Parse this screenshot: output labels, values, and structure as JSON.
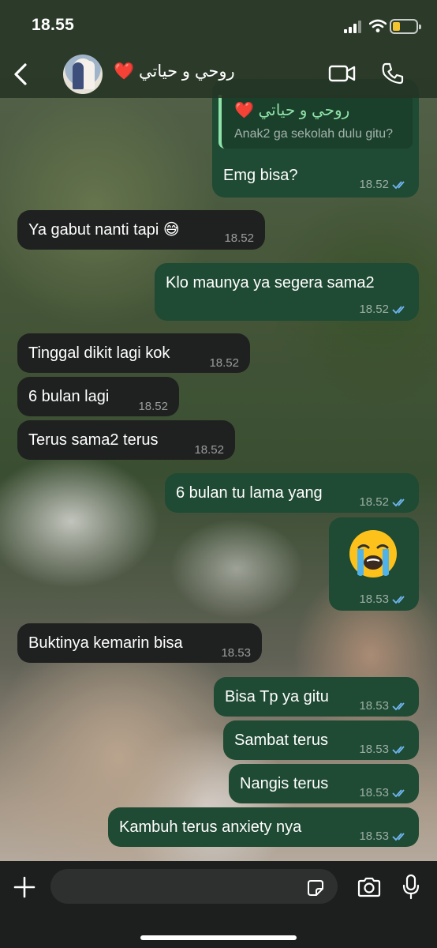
{
  "status_bar": {
    "time": "18.55"
  },
  "header": {
    "contact_name": "روحي و حياتي",
    "heart": "❤️"
  },
  "messages": [
    {
      "id": "m1",
      "dir": "out",
      "reply_to": {
        "name": "روحي و حياتي",
        "heart": "❤️",
        "text": "Anak2 ga sekolah dulu gitu?"
      },
      "text": "Emg bisa?",
      "time": "18.52",
      "ticks": "read"
    },
    {
      "id": "m2",
      "dir": "in",
      "text": "Ya gabut nanti tapi 😅",
      "time": "18.52"
    },
    {
      "id": "m3",
      "dir": "out",
      "text": "Klo maunya ya segera sama2",
      "time": "18.52",
      "ticks": "read"
    },
    {
      "id": "m4",
      "dir": "in",
      "text": "Tinggal dikit lagi kok",
      "time": "18.52"
    },
    {
      "id": "m5",
      "dir": "in",
      "text": "6 bulan lagi",
      "time": "18.52"
    },
    {
      "id": "m6",
      "dir": "in",
      "text": "Terus sama2 terus",
      "time": "18.52"
    },
    {
      "id": "m7",
      "dir": "out",
      "text": "6 bulan tu lama yang",
      "time": "18.52",
      "ticks": "read"
    },
    {
      "id": "m8",
      "dir": "out",
      "emoji": "loudly-crying-face",
      "time": "18.53",
      "ticks": "read"
    },
    {
      "id": "m9",
      "dir": "in",
      "text": "Buktinya kemarin bisa",
      "time": "18.53"
    },
    {
      "id": "m10",
      "dir": "out",
      "text": "Bisa Tp ya gitu",
      "time": "18.53",
      "ticks": "read"
    },
    {
      "id": "m11",
      "dir": "out",
      "text": "Sambat terus",
      "time": "18.53",
      "ticks": "read"
    },
    {
      "id": "m12",
      "dir": "out",
      "text": "Nangis terus",
      "time": "18.53",
      "ticks": "read"
    },
    {
      "id": "m13",
      "dir": "out",
      "text": "Kambuh terus anxiety nya",
      "time": "18.53",
      "ticks": "read"
    }
  ],
  "composer": {
    "placeholder": ""
  },
  "colors": {
    "outgoing_bubble": "#1f4a33",
    "incoming_bubble": "#1f2020",
    "read_tick": "#6fb6f2",
    "quote_accent": "#8fe3a8",
    "heart": "#e0242d"
  }
}
